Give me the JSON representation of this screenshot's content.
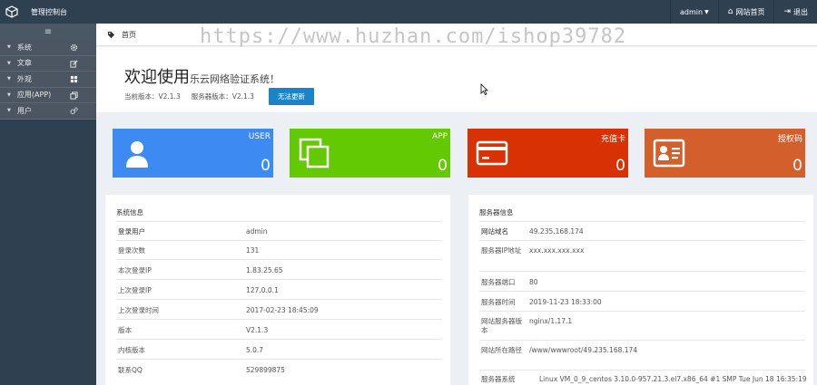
{
  "app": {
    "title": "管理控制台"
  },
  "topnav": {
    "user": "admin",
    "home": "网站首页",
    "logout": "退出"
  },
  "sidebar": {
    "toggle": "≡",
    "items": [
      {
        "label": "系统",
        "icon": "gear-icon"
      },
      {
        "label": "文章",
        "icon": "edit-icon"
      },
      {
        "label": "外观",
        "icon": "grid-icon"
      },
      {
        "label": "应用(APP)",
        "icon": "copy-icon"
      },
      {
        "label": "用户",
        "icon": "gears-icon"
      }
    ]
  },
  "breadcrumb": {
    "current": "首页"
  },
  "watermark": "https://www.huzhan.com/ishop39782",
  "welcome": {
    "heading": "欢迎使用",
    "subheading": "乐云网络验证系统！",
    "current_version": "当前版本：V2.1.3",
    "server_version": "服务器版本：V2.1.3",
    "update_button": "无法更新"
  },
  "cards": [
    {
      "label": "USER",
      "value": "0",
      "color": "#3d8bf2",
      "icon": "user-icon"
    },
    {
      "label": "APP",
      "value": "0",
      "color": "#62c902",
      "icon": "windows-icon"
    },
    {
      "label": "充值卡",
      "value": "0",
      "color": "#d73104",
      "icon": "credit-card-icon"
    },
    {
      "label": "授权码",
      "value": "0",
      "color": "#d25f2c",
      "icon": "id-card-icon"
    }
  ],
  "system_info": {
    "title": "系统信息",
    "rows": [
      {
        "key": "登录用户",
        "value": "admin"
      },
      {
        "key": "登录次数",
        "value": "131"
      },
      {
        "key": "本次登录IP",
        "value": "1.83.25.65"
      },
      {
        "key": "上次登录IP",
        "value": "127.0.0.1"
      },
      {
        "key": "上次登录时间",
        "value": "2017-02-23 18:45:09"
      },
      {
        "key": "版本",
        "value": "V2.1.3"
      },
      {
        "key": "内核版本",
        "value": "5.0.7"
      },
      {
        "key": "联系QQ",
        "value": "529899875"
      }
    ]
  },
  "server_info": {
    "title": "服务器信息",
    "rows": [
      {
        "key": "网站域名",
        "value": "49.235.168.174"
      },
      {
        "key": "服务器IP地址",
        "value": "xxx.xxx.xxx.xxx"
      },
      {
        "key": "服务器端口",
        "value": "80"
      },
      {
        "key": "服务器时间",
        "value": "2019-11-23 18:33:00"
      },
      {
        "key": "网站服务器版本",
        "value": "nginx/1.17.1"
      },
      {
        "key": "网站所在路径",
        "value": "/www/wwwroot/49.235.168.174"
      },
      {
        "key": "服务器系统",
        "value": "Linux VM_0_9_centos 3.10.0-957.21.3.el7.x86_64 #1 SMP Tue Jun 18 16:35:19"
      }
    ]
  }
}
